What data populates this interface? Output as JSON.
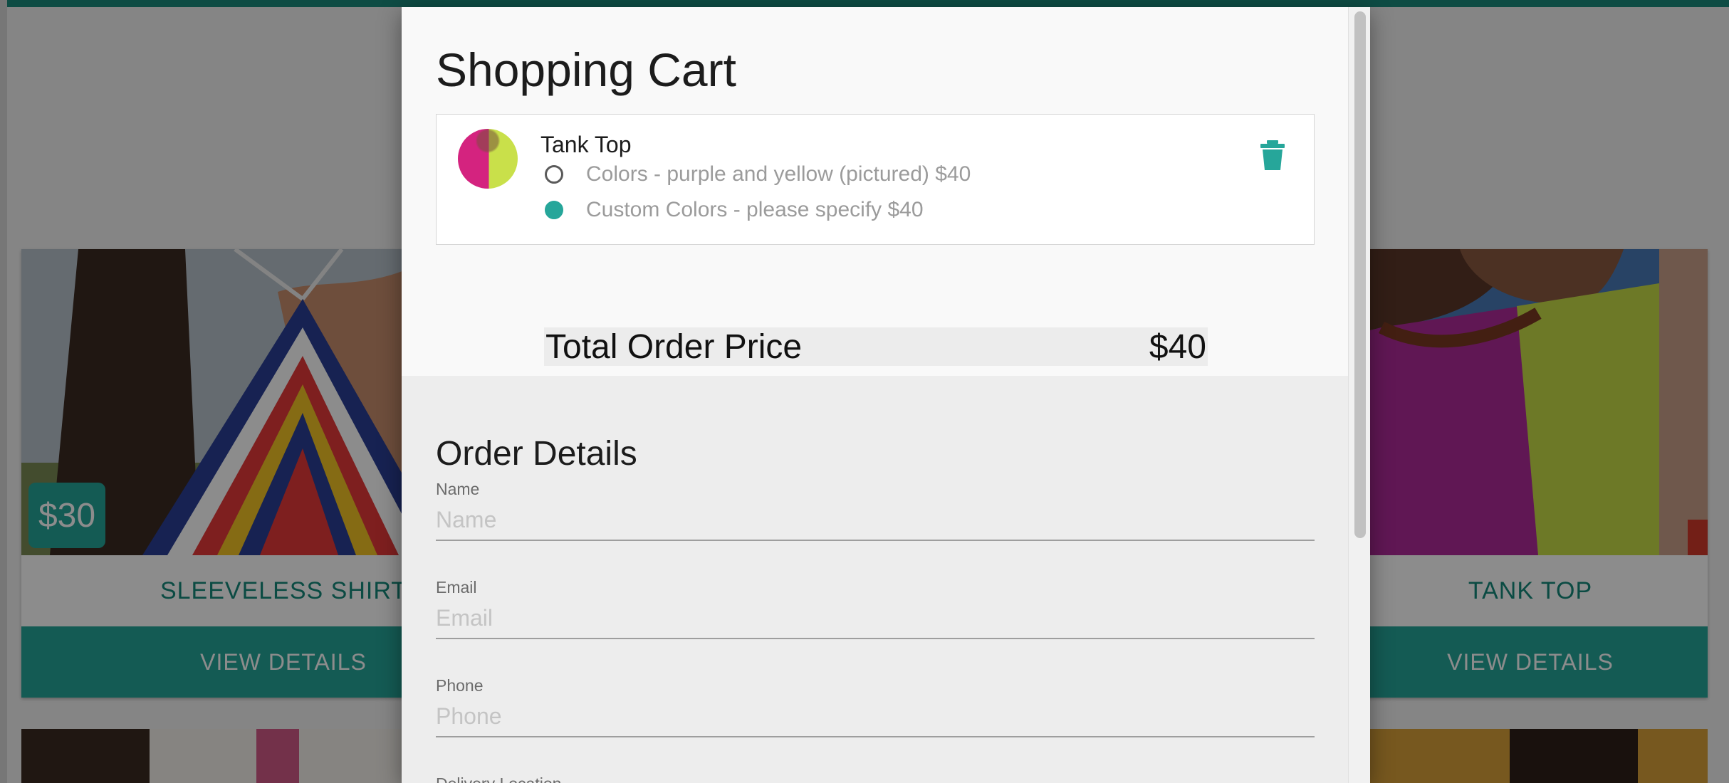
{
  "background": {
    "products": [
      {
        "title": "SLEEVELESS SHIRT",
        "price": "$30",
        "cta": "VIEW DETAILS"
      },
      {
        "title": "TANK TOP",
        "cta": "VIEW DETAILS"
      }
    ]
  },
  "cart": {
    "title": "Shopping Cart",
    "item": {
      "name": "Tank Top",
      "options": [
        {
          "label": "Colors - purple and yellow (pictured) $40",
          "selected": false
        },
        {
          "label": "Custom Colors - please specify $40",
          "selected": true
        }
      ]
    },
    "total_label": "Total Order Price",
    "total_value": "$40"
  },
  "order": {
    "title": "Order Details",
    "fields": [
      {
        "label": "Name",
        "placeholder": "Name"
      },
      {
        "label": "Email",
        "placeholder": "Email"
      },
      {
        "label": "Phone",
        "placeholder": "Phone"
      },
      {
        "label": "Delivery Location"
      }
    ]
  },
  "colors": {
    "accent": "#26a69a",
    "accent_dark": "#15897b"
  }
}
